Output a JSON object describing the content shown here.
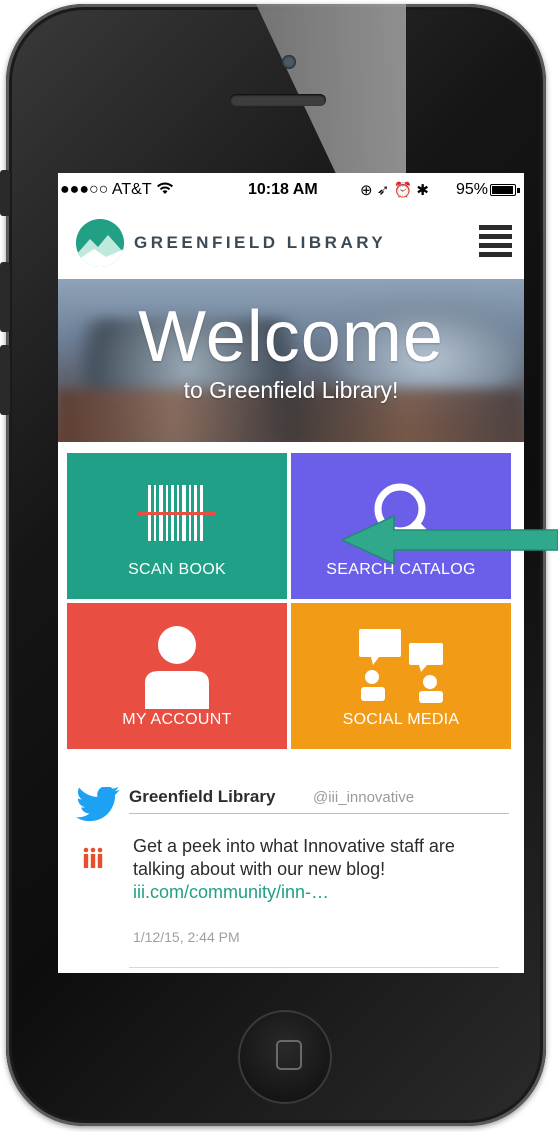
{
  "status_bar": {
    "carrier": "●●●○○ AT&T",
    "time": "10:18 AM",
    "icons": "⊕ ➶ ⏰ ✱",
    "battery_pct": "95%",
    "battery_level": 0.95
  },
  "header": {
    "brand": "GREENFIELD LIBRARY",
    "menu_icon": "hamburger-menu-icon"
  },
  "hero": {
    "title": "Welcome",
    "subtitle": "to Greenfield Library!"
  },
  "tiles": [
    {
      "label": "SCAN BOOK",
      "icon": "barcode-icon",
      "color": "#1fa087"
    },
    {
      "label": "SEARCH CATALOG",
      "icon": "magnifier-icon",
      "color": "#6b5ee8"
    },
    {
      "label": "MY ACCOUNT",
      "icon": "user-icon",
      "color": "#e84e42"
    },
    {
      "label": "SOCIAL MEDIA",
      "icon": "chat-people-icon",
      "color": "#f29b17"
    }
  ],
  "tweet": {
    "name": "Greenfield Library",
    "handle": "@iii_innovative",
    "text": "Get a peek into what Innovative staff are talking about with our new blog!",
    "link": "iii.com/community/inn-…",
    "time": "1/12/15, 2:44 PM"
  },
  "colors": {
    "accent_green": "#1fa087",
    "arrow": "#2fa88c",
    "twitter_blue": "#1da1f2"
  }
}
